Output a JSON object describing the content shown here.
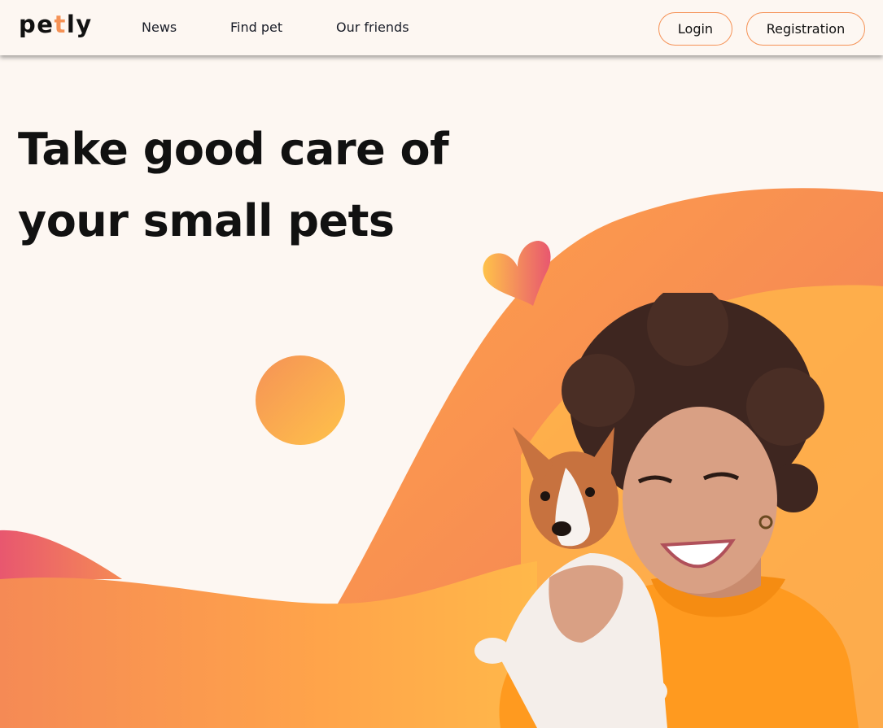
{
  "header": {
    "logo": {
      "prefix": "pe",
      "accent": "t",
      "suffix": "ly"
    },
    "nav": [
      {
        "label": "News"
      },
      {
        "label": "Find pet"
      },
      {
        "label": "Our friends"
      }
    ],
    "login_label": "Login",
    "registration_label": "Registration"
  },
  "hero": {
    "title_line1": "Take good care of",
    "title_line2": "your small pets"
  },
  "colors": {
    "background": "#FDF7F2",
    "accent": "#F59256",
    "orange_light": "#FFC24A",
    "pink": "#E8576F",
    "text": "#111111"
  },
  "images": {
    "hero_photo": "woman-holding-puppy",
    "decorations": [
      "heart-icon",
      "sun-circle",
      "orange-wave"
    ]
  }
}
